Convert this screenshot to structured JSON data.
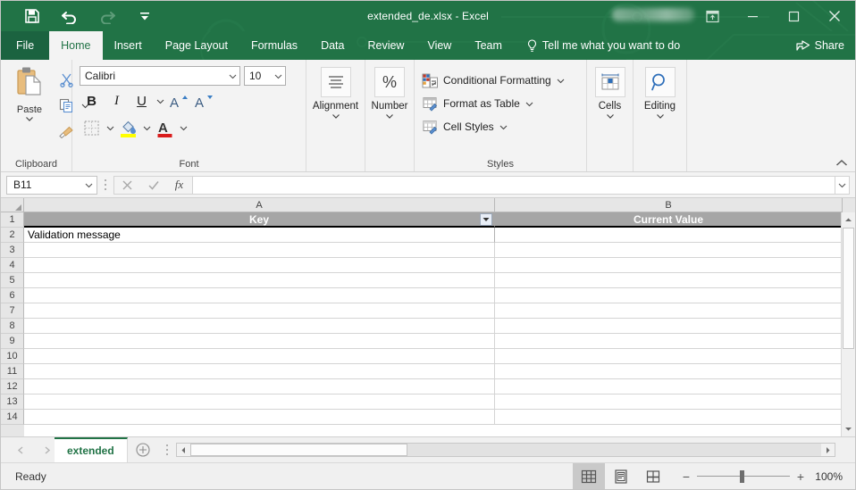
{
  "window": {
    "title": "extended_de.xlsx  -  Excel",
    "quick_access": [
      {
        "name": "save-button",
        "label": "Save"
      },
      {
        "name": "undo-button",
        "label": "Undo"
      },
      {
        "name": "redo-button",
        "label": "Redo"
      },
      {
        "name": "customize-quick-access-toolbar",
        "label": "Customize Quick Access Toolbar"
      }
    ],
    "controls": {
      "ribbon_display_options": "Ribbon Display Options",
      "minimize": "Minimize",
      "maximize": "Restore Down",
      "close": "Close"
    }
  },
  "tabs": [
    {
      "label": "File",
      "active": false
    },
    {
      "label": "Home",
      "active": true
    },
    {
      "label": "Insert",
      "active": false
    },
    {
      "label": "Page Layout",
      "active": false
    },
    {
      "label": "Formulas",
      "active": false
    },
    {
      "label": "Data",
      "active": false
    },
    {
      "label": "Review",
      "active": false
    },
    {
      "label": "View",
      "active": false
    },
    {
      "label": "Team",
      "active": false
    }
  ],
  "tell_me": "Tell me what you want to do",
  "share": "Share",
  "ribbon": {
    "groups": [
      {
        "label": "Clipboard"
      },
      {
        "label": "Font"
      },
      {
        "label": "Alignment"
      },
      {
        "label": "Number"
      },
      {
        "label": "Styles"
      },
      {
        "label": "Cells"
      },
      {
        "label": "Editing"
      }
    ],
    "clipboard": {
      "paste_label": "Paste",
      "cut_label": "Cut",
      "copy_label": "Copy",
      "format_painter_label": "Format Painter"
    },
    "font": {
      "family": "Calibri",
      "size": "10",
      "bold": "B",
      "italic": "I",
      "underline": "U",
      "grow_font": "A",
      "shrink_font": "A",
      "borders_label": "Borders",
      "fill_color_label": "Fill Color",
      "font_color_label": "Font Color"
    },
    "alignment": {
      "label": "Alignment"
    },
    "number": {
      "label": "Number",
      "symbol": "%"
    },
    "styles": {
      "items": [
        {
          "label": "Conditional Formatting",
          "icon": "conditional-formatting-icon"
        },
        {
          "label": "Format as Table",
          "icon": "format-as-table-icon"
        },
        {
          "label": "Cell Styles",
          "icon": "cell-styles-icon"
        }
      ]
    },
    "cells": {
      "label": "Cells"
    },
    "editing": {
      "label": "Editing"
    },
    "collapse_ribbon": "Collapse the Ribbon"
  },
  "formula_bar": {
    "name_box_value": "B11",
    "cancel_label": "Cancel",
    "enter_label": "Enter",
    "insert_function_label": "fx",
    "formula_value": "",
    "expand_label": "Expand Formula Bar"
  },
  "grid": {
    "columns": [
      {
        "id": "A",
        "label": "A"
      },
      {
        "id": "B",
        "label": "B"
      }
    ],
    "rows": [
      "1",
      "2",
      "3",
      "4",
      "5",
      "6",
      "7",
      "8",
      "9",
      "10",
      "11",
      "12",
      "13",
      "14"
    ],
    "table_header": {
      "a": "Key",
      "b": "Current Value",
      "filter_label": "Filter"
    },
    "data": [
      {
        "row": "2",
        "a": "Validation message",
        "b": ""
      },
      {
        "row": "3",
        "a": "",
        "b": ""
      },
      {
        "row": "4",
        "a": "",
        "b": ""
      },
      {
        "row": "5",
        "a": "",
        "b": ""
      },
      {
        "row": "6",
        "a": "",
        "b": ""
      },
      {
        "row": "7",
        "a": "",
        "b": ""
      },
      {
        "row": "8",
        "a": "",
        "b": ""
      },
      {
        "row": "9",
        "a": "",
        "b": ""
      },
      {
        "row": "10",
        "a": "",
        "b": ""
      },
      {
        "row": "11",
        "a": "",
        "b": ""
      },
      {
        "row": "12",
        "a": "",
        "b": ""
      },
      {
        "row": "13",
        "a": "",
        "b": ""
      },
      {
        "row": "14",
        "a": "",
        "b": ""
      }
    ]
  },
  "sheet_tabs": {
    "prev_label": "Previous Sheet",
    "next_label": "Next Sheet",
    "sheets": [
      {
        "name": "extended",
        "active": true
      }
    ],
    "new_sheet_label": "New sheet"
  },
  "status_bar": {
    "status": "Ready",
    "views": [
      {
        "name": "normal-view-button",
        "label": "Normal",
        "active": true
      },
      {
        "name": "page-layout-view-button",
        "label": "Page Layout",
        "active": false
      },
      {
        "name": "page-break-preview-button",
        "label": "Page Break Preview",
        "active": false
      }
    ],
    "zoom_out_label": "−",
    "zoom_in_label": "+",
    "zoom_level": "100%"
  },
  "colors": {
    "brand_green": "#217346",
    "file_tab_green": "#1b6340",
    "ribbon_bg": "#f3f3f3",
    "table_header_gray": "#a6a6a6",
    "grid_line": "#d4d4d4"
  }
}
